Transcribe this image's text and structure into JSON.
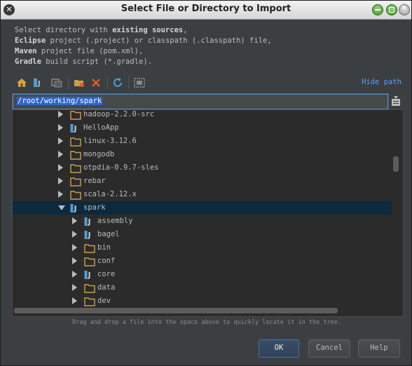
{
  "window": {
    "title": "Select File or Directory to Import"
  },
  "description": {
    "line1_pre": "Select directory with ",
    "line1_bold": "existing sources",
    "line1_post": ",",
    "line2_bold": "Eclipse",
    "line2_post": " project (.project) or classpath (.classpath) file,",
    "line3_bold": "Maven",
    "line3_post": " project file (pom.xml),",
    "line4_bold": "Gradle",
    "line4_post": " build script (*.gradle)."
  },
  "toolbar": {
    "icons": [
      "home-icon",
      "project-icon",
      "module-icon",
      "new-folder-icon",
      "delete-icon",
      "refresh-icon",
      "show-hidden-icon"
    ],
    "hide_path": "Hide path"
  },
  "path": {
    "value": "/root/working/spark"
  },
  "tree": {
    "items": [
      {
        "label": "hadoop-2.2.0-src",
        "icon": "folder-icon",
        "depth": 1,
        "expanded": false
      },
      {
        "label": "HelloApp",
        "icon": "module-icon",
        "depth": 1,
        "expanded": false
      },
      {
        "label": "linux-3.12.6",
        "icon": "folder-icon",
        "depth": 1,
        "expanded": false
      },
      {
        "label": "mongodb",
        "icon": "folder-icon",
        "depth": 1,
        "expanded": false
      },
      {
        "label": "otpdia-0.9.7-sles",
        "icon": "folder-icon",
        "depth": 1,
        "expanded": false
      },
      {
        "label": "rebar",
        "icon": "folder-icon",
        "depth": 1,
        "expanded": false
      },
      {
        "label": "scala-2.12.x",
        "icon": "folder-icon",
        "depth": 1,
        "expanded": false
      },
      {
        "label": "spark",
        "icon": "module-icon",
        "depth": 1,
        "expanded": true,
        "selected": true
      },
      {
        "label": "assembly",
        "icon": "module-icon",
        "depth": 2,
        "expanded": false
      },
      {
        "label": "bagel",
        "icon": "module-icon",
        "depth": 2,
        "expanded": false
      },
      {
        "label": "bin",
        "icon": "folder-icon",
        "depth": 2,
        "expanded": false
      },
      {
        "label": "conf",
        "icon": "folder-icon",
        "depth": 2,
        "expanded": false
      },
      {
        "label": "core",
        "icon": "module-icon",
        "depth": 2,
        "expanded": false
      },
      {
        "label": "data",
        "icon": "folder-icon",
        "depth": 2,
        "expanded": false
      },
      {
        "label": "dev",
        "icon": "folder-icon",
        "depth": 2,
        "expanded": false
      }
    ]
  },
  "hint": "Drag and drop a file into the space above to quickly locate it in the tree.",
  "buttons": {
    "ok": "OK",
    "cancel": "Cancel",
    "help": "Help"
  },
  "colors": {
    "background": "#3c3f41",
    "tree_bg": "#2b2b2b",
    "selection": "#0d293e",
    "link": "#589df6",
    "folder": "#c9a04a",
    "module": "#4f9fd8"
  }
}
